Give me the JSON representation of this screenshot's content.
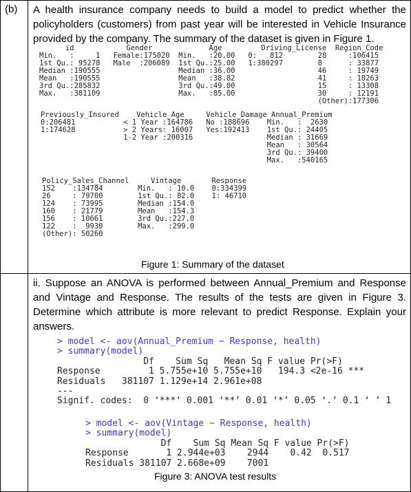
{
  "question_label": "(b)",
  "intro": "A health insurance company needs to build a model to predict whether the policyholders (customers) from past year will be interested in Vehicle Insurance provided by the company. The summary of the dataset is given in Figure 1.",
  "summary_blocks": [
    [
      "      id            Gender             Age         Driving_License  Region_Code",
      "Min.   :     1   Female:175020  Min.   :20.00   0:   812        28     :106415",
      "1st Qu.: 95278   Male  :206089  1st Qu.:25.00   1:380297        8      : 33877",
      "Median :190555                  Median :36.00                   46     : 19749",
      "Mean   :190555                  Mean   :38.82                   41     : 18263",
      "3rd Qu.:285832                  3rd Qu.:49.00                   15     : 13308",
      "Max.   :381109                  Max.   :85.00                   30     : 12191",
      "                                                                (Other):177306"
    ],
    [
      "Previously_Insured    Vehicle_Age     Vehicle_Damage Annual_Premium",
      "0:206481           < 1 Year :164786   No :188696    Min.   :  2630",
      "1:174628           > 2 Years: 16007   Yes:192413    1st Qu.: 24405",
      "                   1-2 Year :200316                 Median : 31669",
      "                                                    Mean   : 30564",
      "                                                    3rd Qu.: 39400",
      "                                                    Max.   :540165"
    ],
    [
      "Policy_Sales_Channel     Vintage       Response",
      "152    :134784        Min.   : 10.0    0:334399",
      "26     : 79700        1st Qu.: 82.0    1: 46710",
      "124    : 73995        Median :154.0",
      "160    : 21779        Mean   :154.3",
      "156    : 10661        3rd Qu.:227.0",
      "122    :  9930        Max.   :299.0",
      "(Other): 50260"
    ]
  ],
  "figure1_caption": "Figure 1: Summary of the dataset",
  "question_ii": "ii. Suppose an ANOVA is performed between Annual_Premium and Response and Vintage and Response. The results of the tests are given in Figure 3. Determine which attribute is more relevant to predict Response. Explain your answers.",
  "anova1": {
    "prompts": [
      "> model <- aov(Annual_Premium ~ Response, health)",
      "> summary(model)"
    ],
    "output": [
      "                Df    Sum Sq   Mean Sq F value Pr(>F)",
      "Response         1 5.755e+10 5.755e+10   194.3 <2e-16 ***",
      "Residuals   381107 1.129e+14 2.961e+08",
      "---",
      "Signif. codes:  0 ‘***’ 0.001 ‘**’ 0.01 ‘*’ 0.05 ‘.’ 0.1 ‘ ’ 1"
    ]
  },
  "anova2": {
    "prompts": [
      "> model <- aov(Vintage ~ Response, health)",
      "> summary(model)"
    ],
    "output": [
      "              Df    Sum Sq Mean Sq F value Pr(>F)",
      "Response       1 2.944e+03    2944    0.42  0.517",
      "Residuals 381107 2.668e+09    7001"
    ]
  },
  "figure3_caption": "Figure 3: ANOVA test results",
  "colors": {
    "prompt": "#4433dd",
    "output": "#222222"
  }
}
